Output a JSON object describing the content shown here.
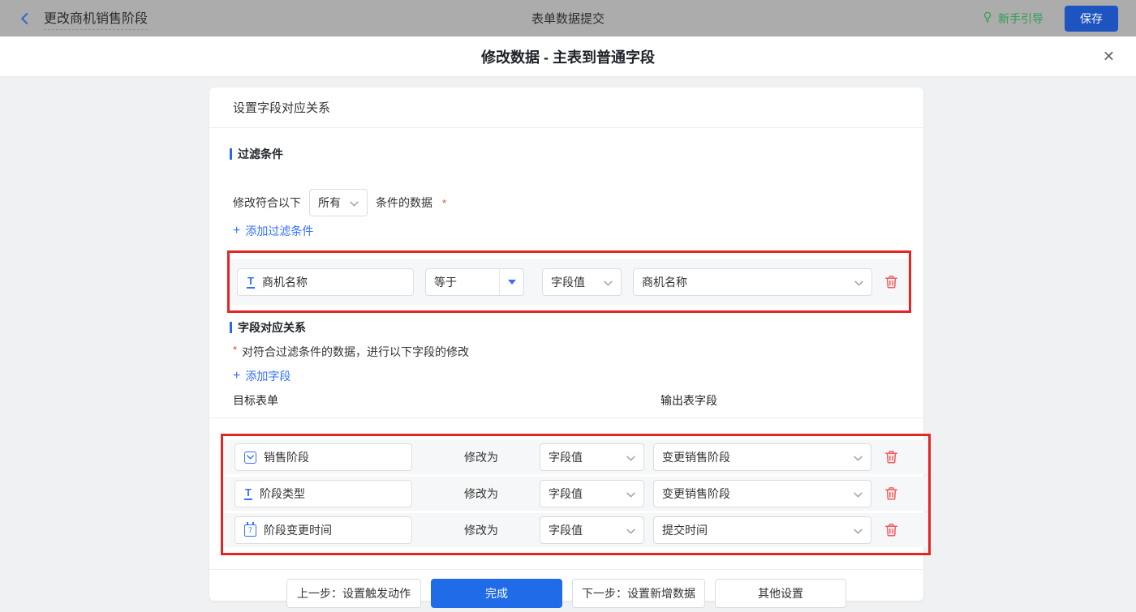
{
  "topbar": {
    "back_label": "更改商机销售阶段",
    "center_title": "表单数据提交",
    "guide_label": "新手引导",
    "save_label": "保存"
  },
  "modal": {
    "title": "修改数据 - 主表到普通字段",
    "close_glyph": "✕"
  },
  "icons": {
    "plus_glyph": "+",
    "text_glyph": "T",
    "date_glyph": "7"
  },
  "card": {
    "header": "设置字段对应关系",
    "filter": {
      "title": "过滤条件",
      "cond_prefix": "修改符合以下",
      "cond_select": "所有",
      "cond_suffix": "条件的数据",
      "required": "*",
      "add_label": "添加过滤条件",
      "row": {
        "field": "商机名称",
        "operator": "等于",
        "value_type": "字段值",
        "value": "商机名称"
      }
    },
    "mapping": {
      "title": "字段对应关系",
      "required": "*",
      "desc": "对符合过滤条件的数据，进行以下字段的修改",
      "add_label": "添加字段",
      "col_target": "目标表单",
      "col_output": "输出表字段",
      "rows": [
        {
          "field": "销售阶段",
          "modify": "修改为",
          "value_type": "字段值",
          "output": "变更销售阶段"
        },
        {
          "field": "阶段类型",
          "modify": "修改为",
          "value_type": "字段值",
          "output": "变更销售阶段"
        },
        {
          "field": "阶段变更时间",
          "modify": "修改为",
          "value_type": "字段值",
          "output": "提交时间"
        }
      ]
    },
    "footer": {
      "prev": "上一步：设置触发动作",
      "done": "完成",
      "next": "下一步：设置新增数据",
      "other": "其他设置"
    }
  },
  "colors": {
    "accent_blue": "#3370ff",
    "annotation_red": "#e12626",
    "guide_green": "#2f9e52",
    "danger_red": "#f15b5b",
    "save_blue": "#1d54c0",
    "done_blue": "#1f6be8"
  }
}
